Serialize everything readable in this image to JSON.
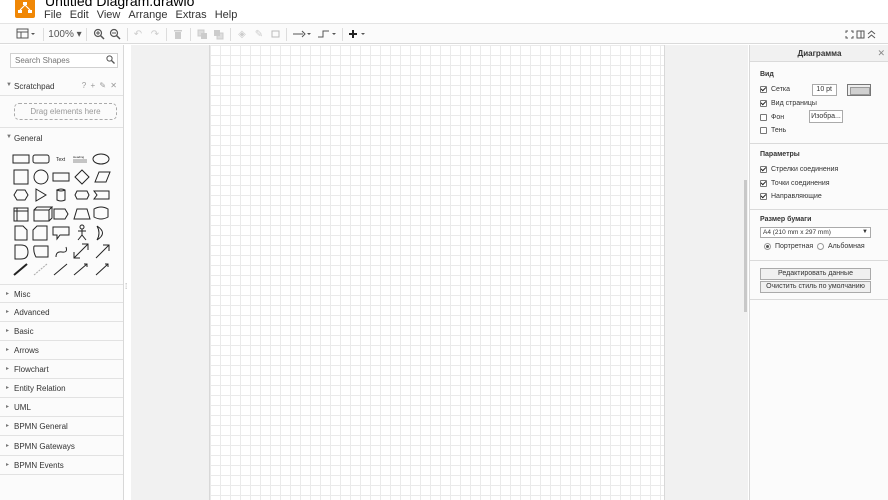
{
  "header": {
    "doc_title": "Untitled Diagram.drawio",
    "menu": [
      "File",
      "Edit",
      "View",
      "Arrange",
      "Extras",
      "Help"
    ]
  },
  "toolbar": {
    "zoom": "100%"
  },
  "sidebar": {
    "search_placeholder": "Search Shapes",
    "scratchpad_label": "Scratchpad",
    "scratchpad_tools": "? + ✎ ✕",
    "dropzone_text": "Drag elements here",
    "general_label": "General",
    "sections": [
      "Misc",
      "Advanced",
      "Basic",
      "Arrows",
      "Flowchart",
      "Entity Relation",
      "UML",
      "BPMN General",
      "BPMN Gateways",
      "BPMN Events"
    ],
    "shape_text_label": "Text",
    "shape_textbox_label": "Heading"
  },
  "panel": {
    "title": "Диаграмма",
    "view_head": "Вид",
    "grid_label": "Сетка",
    "grid_size": "10 pt",
    "page_view_label": "Вид страницы",
    "background_label": "Фон",
    "image_button": "Изобра...",
    "shadow_label": "Тень",
    "options_head": "Параметры",
    "connection_arrows": "Стрелки соединения",
    "connection_points": "Точки соединения",
    "guides": "Направляющие",
    "paper_size_head": "Размер бумаги",
    "paper_size_value": "A4 (210 mm x 297 mm)",
    "portrait": "Портретная",
    "landscape": "Альбомная",
    "edit_data": "Редактировать данные",
    "clear_style": "Очистить стиль по умолчанию"
  },
  "colors": {
    "logo": "#f08705",
    "canvas": "#f1f1f1",
    "grid": "#eaeaea"
  }
}
